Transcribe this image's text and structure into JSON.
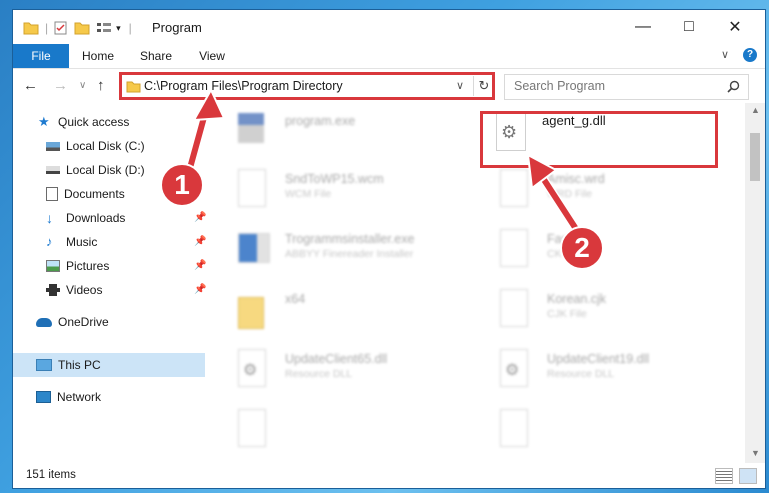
{
  "window": {
    "title": "Program"
  },
  "ribbon": {
    "tabs": [
      "File",
      "Home",
      "Share",
      "View"
    ]
  },
  "address": {
    "path": "C:\\Program Files\\Program Directory"
  },
  "search": {
    "placeholder": "Search Program"
  },
  "nav": {
    "items": [
      {
        "label": "Quick access",
        "icon": "star-icon"
      },
      {
        "label": "Local Disk (C:)",
        "icon": "drive-icon"
      },
      {
        "label": "Local Disk (D:)",
        "icon": "drive-icon"
      },
      {
        "label": "Documents",
        "icon": "documents-icon"
      },
      {
        "label": "Downloads",
        "icon": "download-icon"
      },
      {
        "label": "Music",
        "icon": "music-icon"
      },
      {
        "label": "Pictures",
        "icon": "pictures-icon"
      },
      {
        "label": "Videos",
        "icon": "videos-icon"
      },
      {
        "label": "OneDrive",
        "icon": "cloud-icon"
      },
      {
        "label": "This PC",
        "icon": "computer-icon"
      },
      {
        "label": "Network",
        "icon": "network-icon"
      }
    ]
  },
  "files": [
    {
      "name": "program.exe",
      "type": ""
    },
    {
      "name": "agent_g.dll",
      "type": ""
    },
    {
      "name": "SndToWP15.wcm",
      "type": "WCM File"
    },
    {
      "name": "Amisc.wrd",
      "type": "WRD File"
    },
    {
      "name": "Trogrammsinstaller.exe",
      "type": "ABBYY Finereader Installer"
    },
    {
      "name": "FastK...",
      "type": "CK File"
    },
    {
      "name": "x64",
      "type": ""
    },
    {
      "name": "Korean.cjk",
      "type": "CJK File"
    },
    {
      "name": "UpdateClient65.dll",
      "type": "Resource DLL"
    },
    {
      "name": "UpdateClient19.dll",
      "type": "Resource DLL"
    }
  ],
  "annotations": {
    "step1": "1",
    "step2": "2"
  },
  "status": {
    "count": "151 items"
  },
  "colors": {
    "accent": "#1979ca",
    "highlight": "#d9383c",
    "selected": "#cce4f7"
  }
}
